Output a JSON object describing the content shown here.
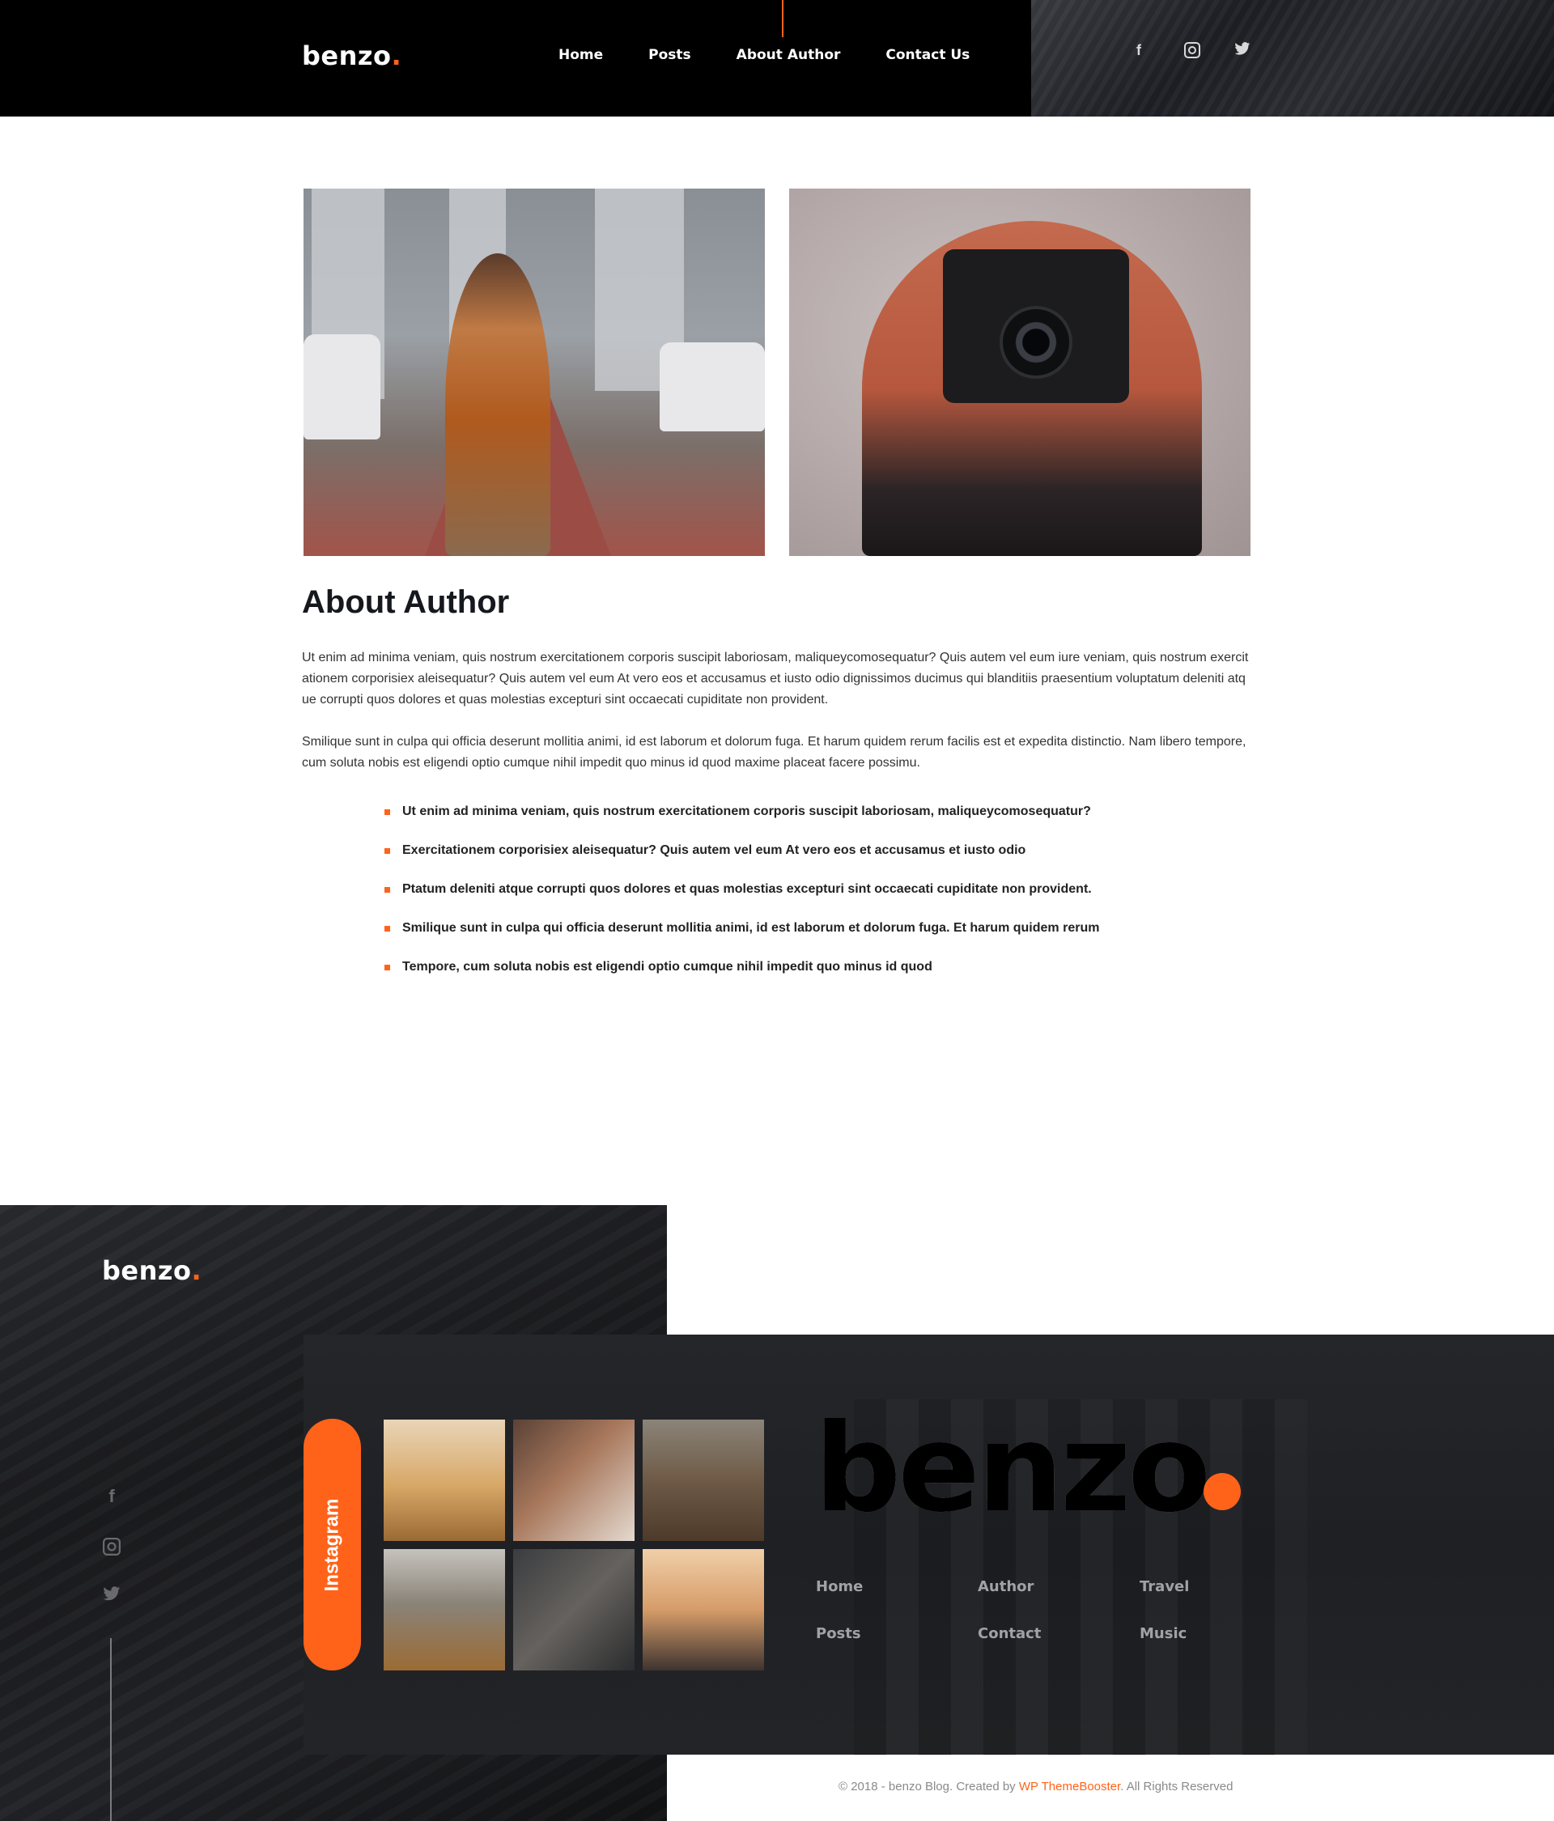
{
  "header": {
    "logo": "benzo",
    "logo_dot": ".",
    "nav": [
      "Home",
      "Posts",
      "About Author",
      "Contact Us"
    ],
    "active_nav": "About Author",
    "social": [
      "facebook-icon",
      "instagram-icon",
      "twitter-icon"
    ]
  },
  "colors": {
    "accent": "#ff6319",
    "dark": "#000000",
    "text": "#15191e"
  },
  "main": {
    "title": "About Author",
    "paragraphs": [
      "Ut enim ad minima veniam, quis nostrum exercitationem corporis suscipit laboriosam, maliqueycomosequatur? Quis autem vel eum iure veniam, quis nostrum exercitationem corporisiex aleisequatur? Quis autem vel eum At vero eos et accusamus et iusto odio dignissimos ducimus qui blanditiis praesentium voluptatum deleniti atque corrupti quos dolores et quas molestias excepturi sint occaecati cupiditate non provident.",
      "Smilique sunt in culpa qui officia deserunt mollitia animi, id est laborum et dolorum fuga. Et harum quidem rerum facilis est et expedita distinctio. Nam libero tempore, cum soluta nobis est eligendi optio cumque nihil impedit quo minus id quod maxime placeat facere possimu."
    ],
    "bullets": [
      "Ut enim ad minima veniam, quis nostrum exercitationem corporis suscipit laboriosam, maliqueycomosequatur?",
      "Exercitationem corporisiex aleisequatur? Quis autem vel eum At vero eos et accusamus et iusto odio",
      "Ptatum deleniti atque corrupti quos dolores et quas molestias excepturi sint occaecati cupiditate non provident.",
      "Smilique sunt in culpa qui officia deserunt mollitia animi, id est laborum et dolorum fuga. Et harum quidem rerum",
      "Tempore, cum soluta nobis est eligendi optio cumque nihil impedit quo minus id quod"
    ]
  },
  "footer": {
    "logo": "benzo",
    "logo_dot": ".",
    "social": [
      "facebook-icon",
      "instagram-icon",
      "twitter-icon"
    ],
    "instagram_label": "Instagram",
    "big_logo": "benzo",
    "links": [
      "Home",
      "Author",
      "Travel",
      "Posts",
      "Contact",
      "Music"
    ],
    "copyright_prefix": "© 2018 - benzo Blog. Created by ",
    "copyright_brand": "WP ThemeBooster",
    "copyright_suffix": ". All Rights Reserved"
  }
}
